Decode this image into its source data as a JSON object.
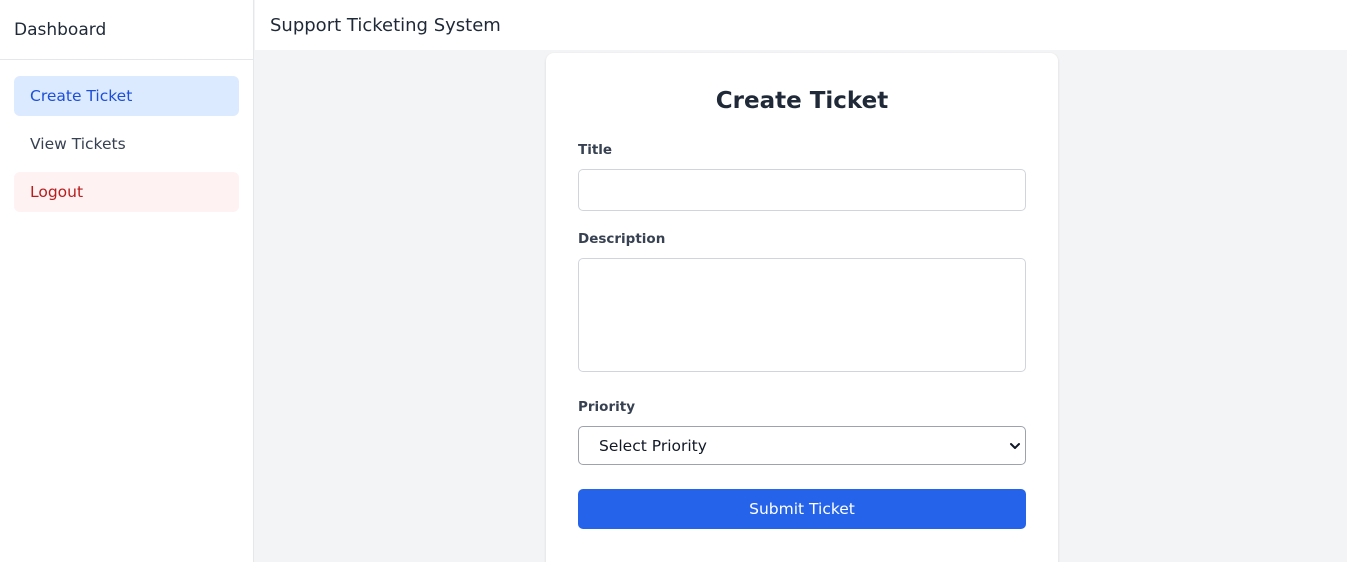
{
  "sidebar": {
    "title": "Dashboard",
    "items": [
      {
        "label": "Create Ticket",
        "state": "active"
      },
      {
        "label": "View Tickets",
        "state": "default"
      },
      {
        "label": "Logout",
        "state": "danger"
      }
    ]
  },
  "header": {
    "title": "Support Ticketing System"
  },
  "form": {
    "heading": "Create Ticket",
    "title_label": "Title",
    "title_value": "",
    "description_label": "Description",
    "description_value": "",
    "priority_label": "Priority",
    "priority_selected": "Select Priority",
    "submit_label": "Submit Ticket"
  },
  "icons": {
    "select_arrow": "chevron-down-icon"
  },
  "colors": {
    "primary": "#2563eb",
    "active_bg": "#dbeafe",
    "active_text": "#1d4ed8",
    "danger_bg": "#fef2f2",
    "danger_text": "#b91c1c",
    "page_bg": "#f3f4f6"
  }
}
